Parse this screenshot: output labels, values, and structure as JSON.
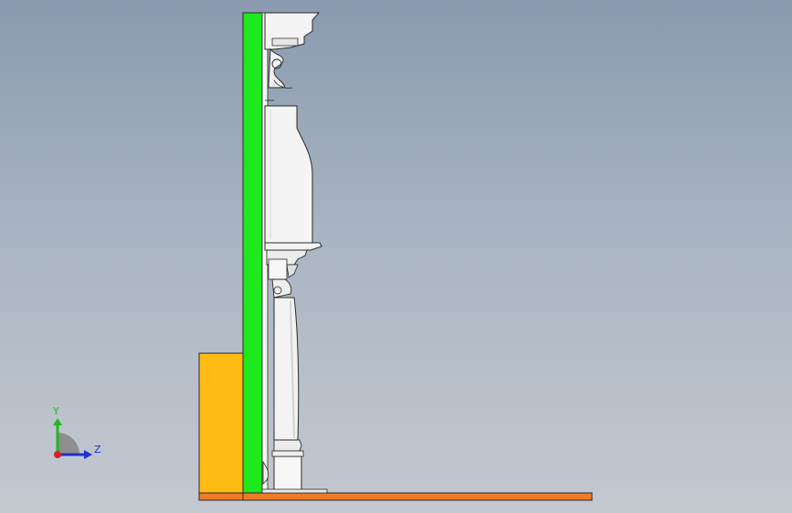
{
  "viewport": {
    "background_top": "#8a9aaf",
    "background_bottom": "#c4c9d0"
  },
  "model": {
    "colors": {
      "green_panel": "#1ee81e",
      "orange_block": "#ffbb14",
      "base_plate": "#f07a28",
      "ornament_white": "#f4f4f4",
      "edge": "#2a2a2a"
    }
  },
  "triad": {
    "y_label": "Y",
    "z_label": "Z",
    "y_color": "#1fb81f",
    "z_color": "#2030d0",
    "origin_color": "#e02020"
  }
}
